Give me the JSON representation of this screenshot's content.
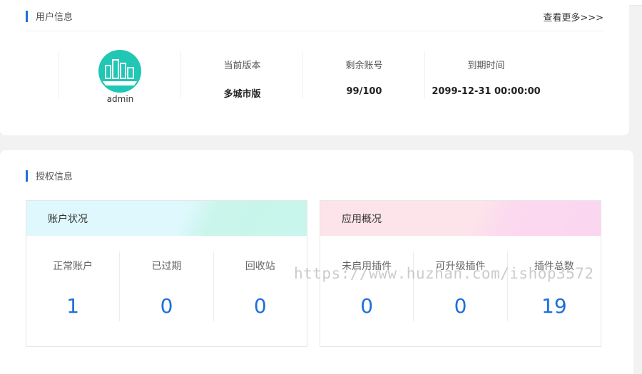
{
  "user_section": {
    "title": "用户信息",
    "more_label": "查看更多>>>",
    "avatar_name": "admin",
    "fields": [
      {
        "label": "当前版本",
        "value": "多城市版"
      },
      {
        "label": "剩余账号",
        "value": "99/100"
      },
      {
        "label": "到期时间",
        "value": "2099-12-31 00:00:00"
      }
    ]
  },
  "auth_section": {
    "title": "授权信息",
    "account_panel": {
      "title": "账户状况",
      "stats": [
        {
          "label": "正常账户",
          "value": "1"
        },
        {
          "label": "已过期",
          "value": "0"
        },
        {
          "label": "回收站",
          "value": "0"
        }
      ]
    },
    "app_panel": {
      "title": "应用概况",
      "stats": [
        {
          "label": "未启用插件",
          "value": "0"
        },
        {
          "label": "可升级插件",
          "value": "0"
        },
        {
          "label": "插件总数",
          "value": "19"
        }
      ]
    }
  },
  "watermark": "https://www.huzhan.com/ishop3572",
  "colors": {
    "accent": "#1e6fd9",
    "avatar": "#1fc7b4"
  }
}
